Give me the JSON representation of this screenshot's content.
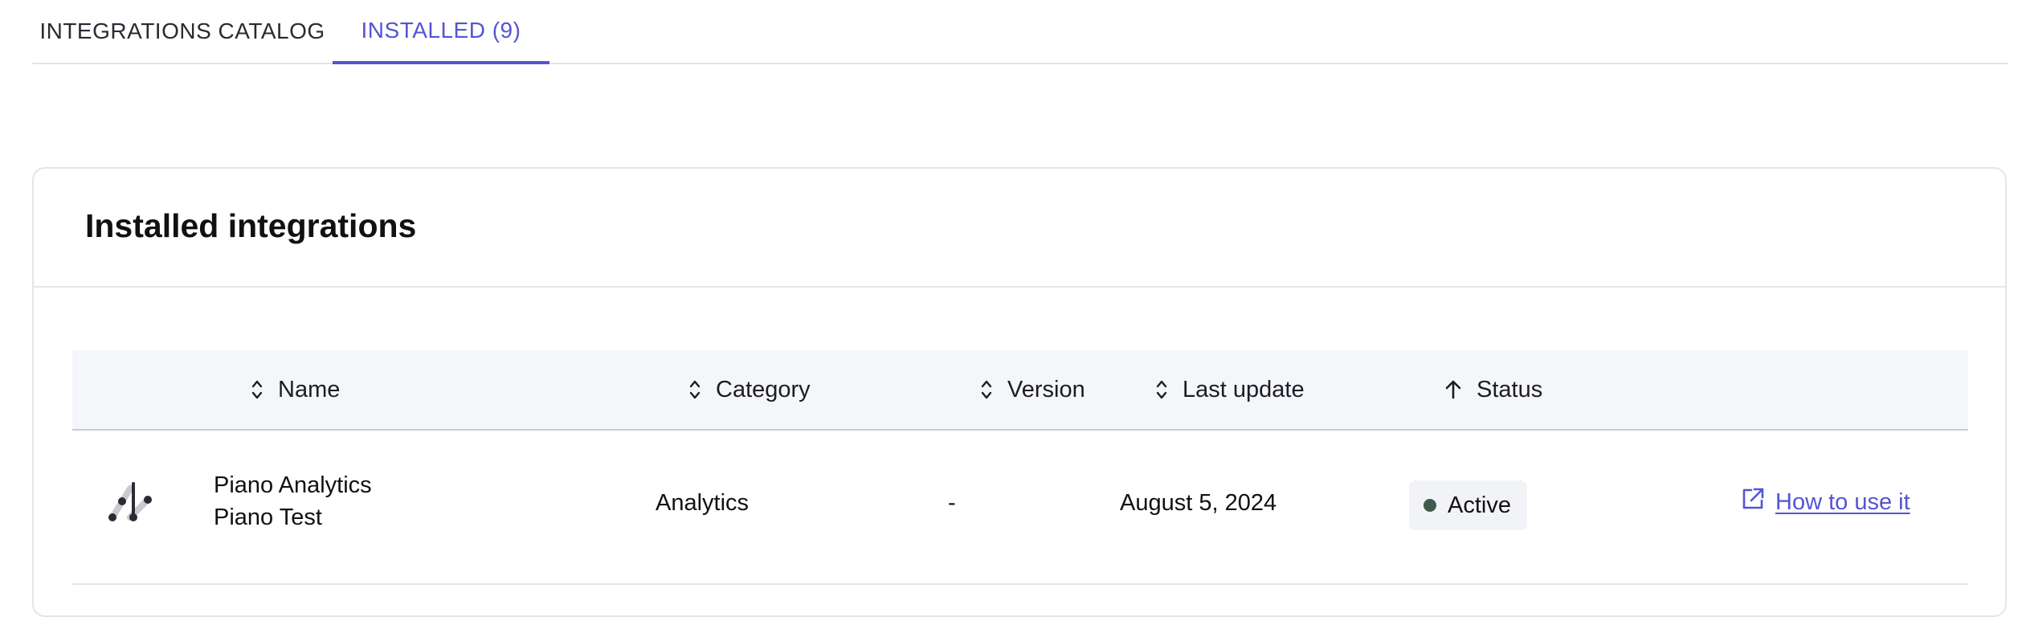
{
  "tabs": [
    {
      "label": "INTEGRATIONS CATALOG",
      "active": false
    },
    {
      "label": "INSTALLED (9)",
      "active": true
    }
  ],
  "card": {
    "title": "Installed integrations"
  },
  "table": {
    "columns": [
      {
        "label": "Name",
        "sort_icon": "sort-icon"
      },
      {
        "label": "Category",
        "sort_icon": "sort-icon"
      },
      {
        "label": "Version",
        "sort_icon": "sort-icon"
      },
      {
        "label": "Last update",
        "sort_icon": "sort-icon"
      },
      {
        "label": "Status",
        "sort_icon": "arrow-up-icon"
      }
    ],
    "rows": [
      {
        "logo_icon": "piano-analytics-logo",
        "name_line1": "Piano Analytics",
        "name_line2": "Piano Test",
        "category": "Analytics",
        "version": "-",
        "last_update": "August 5, 2024",
        "status": "Active",
        "status_color": "#3f5a4a",
        "link_label": "How to use it",
        "link_icon": "external-link-icon"
      }
    ]
  },
  "colors": {
    "accent": "#5454d4",
    "header_bg": "#f5f6fa",
    "badge_bg": "#f2f3f7"
  }
}
